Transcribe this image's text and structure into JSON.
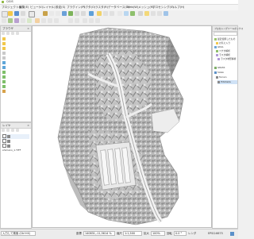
{
  "window": {
    "title": "QGIS"
  },
  "menu": [
    "プロジェクト(J)",
    "編集(E)",
    "ビュー(V)",
    "レイヤ(L)",
    "設定(S)",
    "プラグイン(P)",
    "ベクタ(O)",
    "ラスタ(R)",
    "データベース(D)",
    "Web(W)",
    "メッシュ(M)",
    "プロセシング(C)",
    "ヘルプ(H)"
  ],
  "left_panels": {
    "browser_title": "ブラウザ",
    "layers_title": "レイヤ",
    "layer_item": "shimano_1.TIFF"
  },
  "right_panel": {
    "title": "プロセシングツールボックス",
    "items": [
      "最近使用したもの",
      "お気に入り",
      "GDAL",
      "ベクタ解析",
      "ラスタ解析",
      "ラスタ地形解析",
      "GRASS",
      "SAGA",
      "Terrain",
      "Hillshade"
    ]
  },
  "status": {
    "search_placeholder": "入力して検索 (Ctrl+K)",
    "coord_label": "座標",
    "coord_value": "140831,-11,5614 %",
    "scale_label": "縮尺",
    "scale_value": "1:1,500",
    "zoom_label": "拡大",
    "zoom_value": "100%",
    "rotation_label": "回転",
    "rotation_value": "0.0 °",
    "render_label": "レンダ",
    "crs": "EPSG:6675"
  },
  "colors": {
    "accent": "#8bb43a",
    "map_bg": "#ffffff",
    "toolbar_bg": "#f0f0f0"
  }
}
